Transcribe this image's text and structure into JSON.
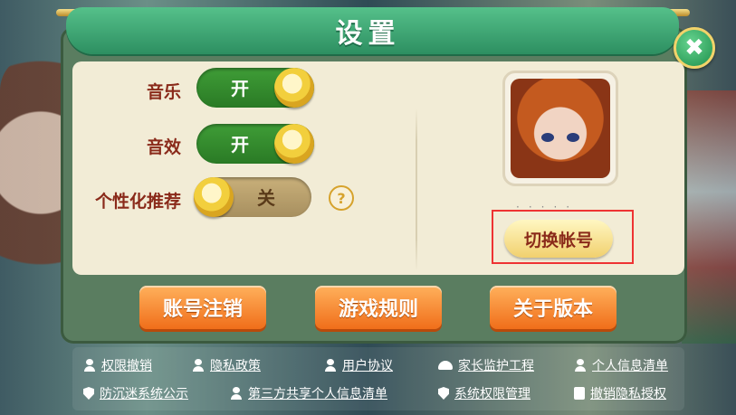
{
  "window": {
    "title": "设置",
    "close_label": "✖"
  },
  "settings": {
    "music": {
      "label": "音乐",
      "state": "开",
      "on": true
    },
    "sound": {
      "label": "音效",
      "state": "开",
      "on": true
    },
    "recommend": {
      "label": "个性化推荐",
      "state": "关",
      "on": false
    },
    "help_label": "?"
  },
  "profile": {
    "dots": "·····",
    "switch_account": "切换帐号"
  },
  "actions": [
    "账号注销",
    "游戏规则",
    "关于版本"
  ],
  "footer_links": [
    {
      "label": "权限撤销",
      "icon": "person-icon"
    },
    {
      "label": "隐私政策",
      "icon": "person-icon"
    },
    {
      "label": "用户协议",
      "icon": "person-icon"
    },
    {
      "label": "家长监护工程",
      "icon": "hand-icon"
    },
    {
      "label": "个人信息清单",
      "icon": "person-icon"
    },
    {
      "label": "防沉迷系统公示",
      "icon": "shield-icon"
    },
    {
      "label": "第三方共享个人信息清单",
      "icon": "person-icon"
    },
    {
      "label": "系统权限管理",
      "icon": "shield-icon"
    },
    {
      "label": "撤销隐私授权",
      "icon": "doc-icon"
    }
  ],
  "colors": {
    "accent_green": "#2d8f61",
    "button_orange": "#f06e1a",
    "highlight_red": "#e33"
  }
}
